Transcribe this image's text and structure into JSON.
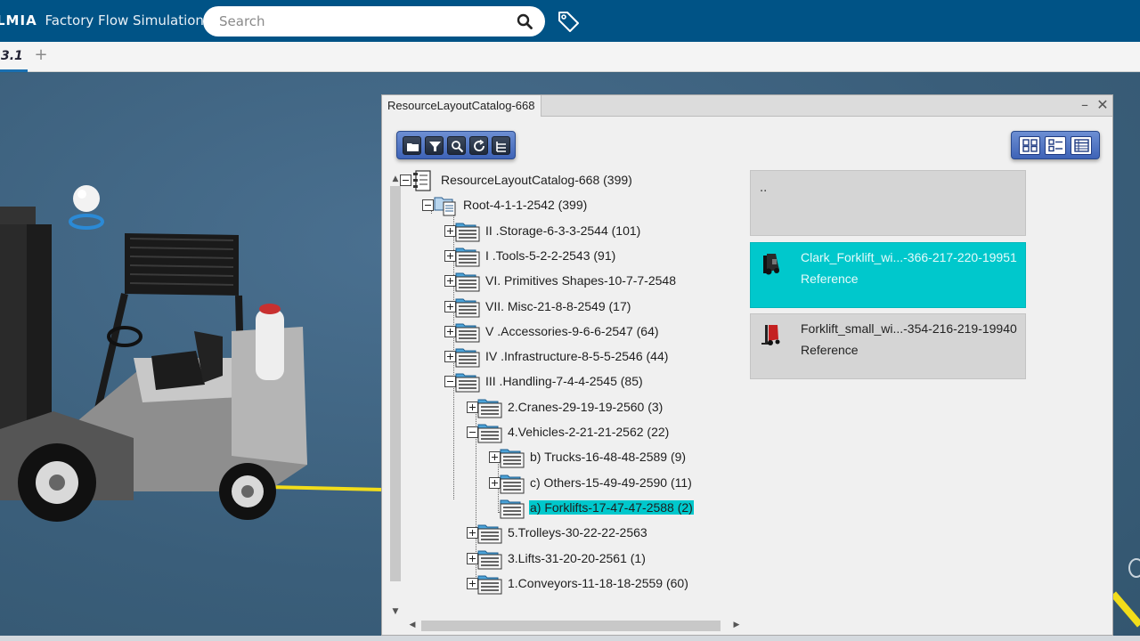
{
  "app": {
    "brand": "LMIA",
    "name": "Factory Flow Simulation"
  },
  "search": {
    "placeholder": "Search",
    "value": ""
  },
  "tabs": [
    {
      "label": "3.1",
      "active": true
    }
  ],
  "tab_add_label": "+",
  "catalog": {
    "title": "ResourceLayoutCatalog-668",
    "minimize_label": "–",
    "close_label": "✕",
    "tree": [
      {
        "label": "ResourceLayoutCatalog-668 (399)",
        "level": 0,
        "expanded": true,
        "icon": "catalog-icon"
      },
      {
        "label": "Root-4-1-1-2542 (399)",
        "level": 1,
        "expanded": true,
        "icon": "root-chapter-icon"
      },
      {
        "label": "II .Storage-6-3-3-2544 (101)",
        "level": 2,
        "expanded": false,
        "icon": "chapter-icon"
      },
      {
        "label": "I .Tools-5-2-2-2543 (91)",
        "level": 2,
        "expanded": false,
        "icon": "chapter-icon"
      },
      {
        "label": "VI. Primitives Shapes-10-7-7-2548",
        "level": 2,
        "expanded": false,
        "icon": "chapter-icon"
      },
      {
        "label": "VII. Misc-21-8-8-2549 (17)",
        "level": 2,
        "expanded": false,
        "icon": "chapter-icon"
      },
      {
        "label": "V .Accessories-9-6-6-2547 (64)",
        "level": 2,
        "expanded": false,
        "icon": "chapter-icon"
      },
      {
        "label": "IV .Infrastructure-8-5-5-2546 (44)",
        "level": 2,
        "expanded": false,
        "icon": "chapter-icon"
      },
      {
        "label": "III .Handling-7-4-4-2545 (85)",
        "level": 2,
        "expanded": true,
        "icon": "chapter-icon"
      },
      {
        "label": "2.Cranes-29-19-19-2560 (3)",
        "level": 3,
        "expanded": false,
        "icon": "chapter-icon"
      },
      {
        "label": "4.Vehicles-2-21-21-2562 (22)",
        "level": 3,
        "expanded": true,
        "icon": "chapter-icon"
      },
      {
        "label": "b) Trucks-16-48-48-2589 (9)",
        "level": 4,
        "expanded": false,
        "icon": "chapter-icon"
      },
      {
        "label": "c) Others-15-49-49-2590 (11)",
        "level": 4,
        "expanded": false,
        "icon": "chapter-icon"
      },
      {
        "label": "a) Forklifts-17-47-47-2588 (2)",
        "level": 4,
        "leaf": true,
        "selected": true,
        "icon": "chapter-icon"
      },
      {
        "label": "5.Trolleys-30-22-22-2563",
        "level": 3,
        "expanded": false,
        "icon": "chapter-icon"
      },
      {
        "label": "3.Lifts-31-20-20-2561 (1)",
        "level": 3,
        "expanded": false,
        "icon": "chapter-icon"
      },
      {
        "label": "1.Conveyors-11-18-18-2559 (60)",
        "level": 3,
        "expanded": false,
        "icon": "chapter-icon"
      }
    ],
    "list": {
      "parent_label": "..",
      "items": [
        {
          "title": "Clark_Forklift_wi...-366-217-220-19951",
          "type": "Reference",
          "selected": true,
          "icon": "forklift-dark-icon"
        },
        {
          "title": "Forklift_small_wi...-354-216-219-19940",
          "type": "Reference",
          "selected": false,
          "icon": "forklift-red-icon"
        }
      ]
    }
  },
  "colors": {
    "topbar": "#005386",
    "selection": "#00c8cc",
    "toolbar": "#3e63b7",
    "viewport": "#3a5f7a"
  }
}
